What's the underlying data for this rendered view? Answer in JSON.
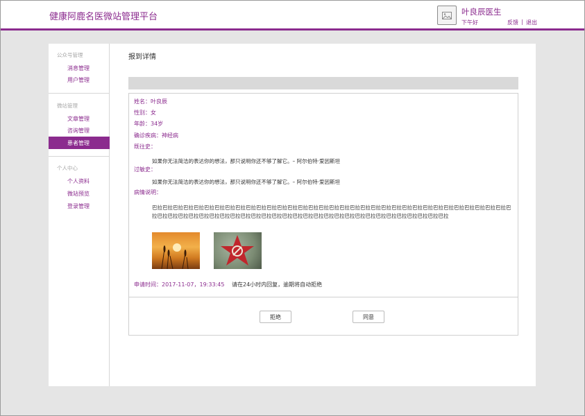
{
  "header": {
    "brand": "健康阿鹿名医微站管理平台",
    "user_name": "叶良辰医生",
    "greeting": "下午好",
    "feedback": "反馈",
    "separator": "|",
    "logout": "退出",
    "avatar_icon": "image-placeholder-icon",
    "accent_color": "#8b2b8e"
  },
  "sidebar": {
    "groups": [
      {
        "title": "公众号管理",
        "items": [
          "消息管理",
          "用户管理"
        ]
      },
      {
        "title": "微站管理",
        "items": [
          "文章管理",
          "咨询管理",
          "患者管理"
        ]
      },
      {
        "title": "个人中心",
        "items": [
          "个人资料",
          "微站预览",
          "登录管理"
        ]
      }
    ],
    "active_item": "患者管理"
  },
  "main": {
    "title": "报到详情",
    "fields": {
      "name": "姓名：叶良辰",
      "gender": "性别：女",
      "age": "年龄：34岁",
      "diagnosis": "确诊疾病：神经病",
      "history_label": "既往史：",
      "history_text": "如果你无法简洁的表达你的想法，那只说明你还不够了解它。– 阿尔伯特·爱因斯坦",
      "allergy_label": "过敏史：",
      "allergy_text": "如果你无法简洁的表达你的想法，那只说明你还不够了解它。– 阿尔伯特·爱因斯坦",
      "condition_label": "病情说明：",
      "condition_text": "巴拉巴拉巴拉巴拉巴拉巴拉巴拉巴拉巴拉巴拉巴拉巴拉巴拉巴拉巴拉巴拉巴拉巴拉巴拉巴拉巴拉巴拉巴拉巴拉巴拉巴拉巴拉巴拉巴拉巴拉巴拉巴拉巴拉巴拉巴拉巴拉巴拉巴拉巴拉巴拉巴拉巴拉巴拉巴拉巴拉巴拉巴拉巴拉巴拉巴拉巴拉巴拉巴拉巴拉巴拉巴拉巴拉巴拉巴拉巴拉巴拉巴拉巴拉"
    },
    "images": [
      "wheat-sunset-photo",
      "red-star-emblem-photo"
    ],
    "apply_time": "申请时间：2017-11-07，19:33:45",
    "notice": "请在24小时内回复，逾期将自动拒绝",
    "reject_button": "拒绝",
    "accept_button": "同意"
  }
}
